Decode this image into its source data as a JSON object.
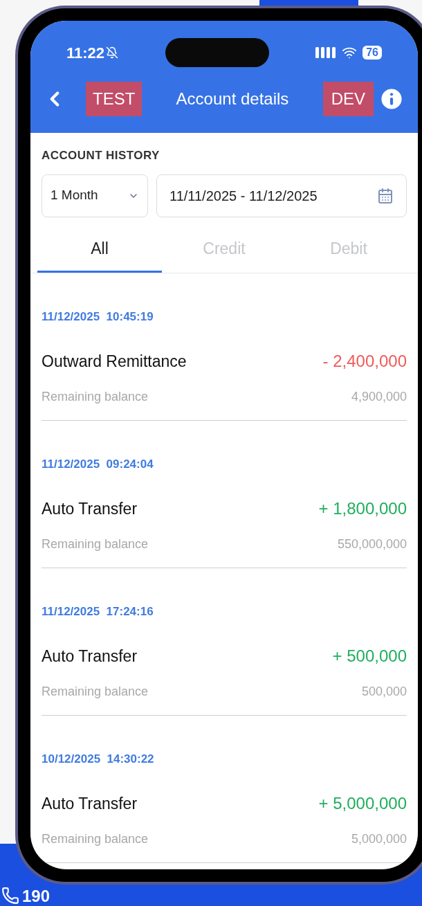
{
  "backdrop": {
    "hotline": "190"
  },
  "status_bar": {
    "time": "11:22",
    "battery": "76"
  },
  "header": {
    "title": "Account details",
    "badges": [
      "TEST",
      "DEV"
    ]
  },
  "section_title": "ACCOUNT HISTORY",
  "filter": {
    "period": "1 Month",
    "date_range": "11/11/2025 - 11/12/2025"
  },
  "tabs": [
    {
      "label": "All",
      "selected": true
    },
    {
      "label": "Credit",
      "selected": false
    },
    {
      "label": "Debit",
      "selected": false
    }
  ],
  "transactions": [
    {
      "datetime": "11/12/2025  10:45:19",
      "title": "Outward Remittance",
      "kind": "debit",
      "amount": "- 2,400,000",
      "balance_label": "Remaining balance",
      "balance": "4,900,000"
    },
    {
      "datetime": "11/12/2025  09:24:04",
      "title": "Auto Transfer",
      "kind": "credit",
      "amount": "+ 1,800,000",
      "balance_label": "Remaining balance",
      "balance": "550,000,000"
    },
    {
      "datetime": "11/12/2025  17:24:16",
      "title": "Auto Transfer",
      "kind": "credit",
      "amount": "+ 500,000",
      "balance_label": "Remaining balance",
      "balance": "500,000"
    },
    {
      "datetime": "10/12/2025  14:30:22",
      "title": "Auto Transfer",
      "kind": "credit",
      "amount": "+ 5,000,000",
      "balance_label": "Remaining balance",
      "balance": "5,000,000"
    }
  ]
}
